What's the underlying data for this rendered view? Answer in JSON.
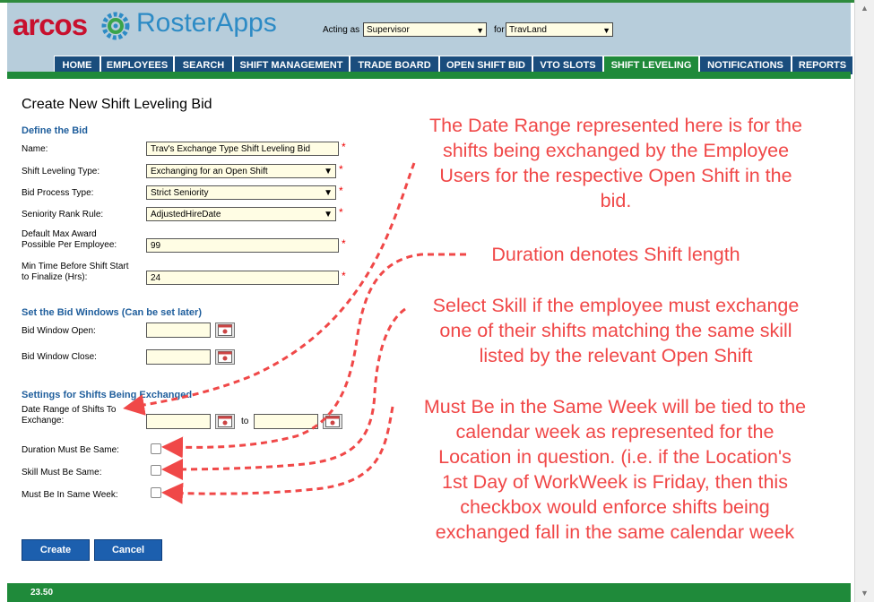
{
  "brand": {
    "arcos": "arcos",
    "rosterapps": "RosterApps"
  },
  "acting": {
    "label_acting": "Acting as",
    "role": "Supervisor",
    "label_for": "for",
    "location": "TravLand"
  },
  "nav": {
    "tabs": [
      {
        "label": "HOME"
      },
      {
        "label": "EMPLOYEES"
      },
      {
        "label": "SEARCH"
      },
      {
        "label": "SHIFT MANAGEMENT"
      },
      {
        "label": "TRADE BOARD"
      },
      {
        "label": "OPEN SHIFT BID"
      },
      {
        "label": "VTO SLOTS"
      },
      {
        "label": "SHIFT LEVELING"
      },
      {
        "label": "NOTIFICATIONS"
      },
      {
        "label": "REPORTS"
      }
    ],
    "active": "SHIFT LEVELING"
  },
  "page": {
    "title": "Create New Shift Leveling Bid"
  },
  "define": {
    "heading": "Define the Bid",
    "name_label": "Name:",
    "name_value": "Trav's Exchange Type Shift Leveling Bid",
    "type_label": "Shift Leveling Type:",
    "type_value": "Exchanging for an Open Shift",
    "process_label": "Bid Process Type:",
    "process_value": "Strict Seniority",
    "rank_label": "Seniority Rank Rule:",
    "rank_value": "AdjustedHireDate",
    "max_label_1": "Default Max Award",
    "max_label_2": "Possible Per Employee:",
    "max_value": "99",
    "min_label_1": "Min Time Before Shift Start",
    "min_label_2": "to Finalize (Hrs):",
    "min_value": "24"
  },
  "windows": {
    "heading": "Set the Bid Windows (Can be set later)",
    "open_label": "Bid Window Open:",
    "close_label": "Bid Window Close:"
  },
  "exchange": {
    "heading": "Settings for Shifts Being Exchanged",
    "range_label_1": "Date Range of Shifts To",
    "range_label_2": "Exchange:",
    "to": "to",
    "duration_label": "Duration Must Be Same:",
    "skill_label": "Skill Must Be Same:",
    "week_label": "Must Be In Same Week:"
  },
  "buttons": {
    "create": "Create",
    "cancel": "Cancel"
  },
  "footer": {
    "version": "23.50"
  },
  "annotations": {
    "date_range": [
      "The Date Range represented here is for the",
      "shifts being exchanged by the Employee",
      "Users for the respective Open Shift in the",
      "bid."
    ],
    "duration": [
      "Duration denotes Shift length"
    ],
    "skill": [
      "Select Skill if the employee must exchange",
      "one of their shifts matching the same skill",
      "listed by the relevant Open Shift"
    ],
    "week": [
      "Must Be in the Same Week will be tied to the",
      "calendar week as represented for the",
      "Location in question. (i.e. if the Location's",
      "1st Day of WorkWeek is Friday, then this",
      "checkbox would enforce shifts being",
      "exchanged fall in the same calendar week"
    ]
  },
  "colors": {
    "annotation": "#f04848",
    "nav_tab": "#1a4d7d",
    "nav_active": "#1f8a3a",
    "header_bg": "#b7cddb",
    "field_bg": "#fffde4",
    "section_heading": "#1f5e9c",
    "button": "#1c5fae"
  }
}
